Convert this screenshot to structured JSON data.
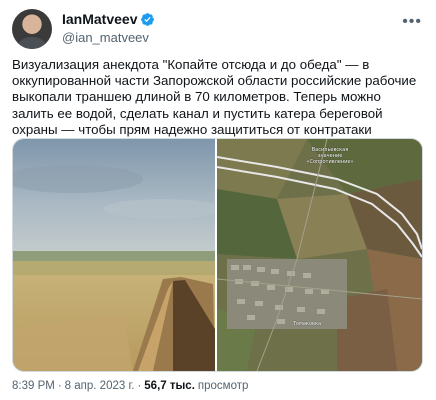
{
  "author": {
    "display_name": "IanMatveev",
    "handle": "@ian_matveev",
    "verified": true,
    "verified_color": "#1d9bf0"
  },
  "tweet": {
    "text": "Визуализация анекдота \"Копайте отсюда и до обеда\" — в оккупированной части Запорожской области российские рабочие выкопали траншею длиной в 70 километров. Теперь можно залить ее водой, сделать канал и пустить катера береговой охраны — чтобы прям надежно защититься от контратаки"
  },
  "media": {
    "satellite_labels": {
      "top": "Васильевская\nзначение\n«Сопротивление»",
      "town": "Томаковка"
    }
  },
  "meta": {
    "time": "8:39 PM",
    "separator1": "·",
    "date": "8 апр. 2023 г.",
    "separator2": "·",
    "views_count": "56,7 тыс.",
    "views_label": "просмотр"
  },
  "icons": {
    "more": "more-icon",
    "verified": "verified-badge-icon"
  }
}
